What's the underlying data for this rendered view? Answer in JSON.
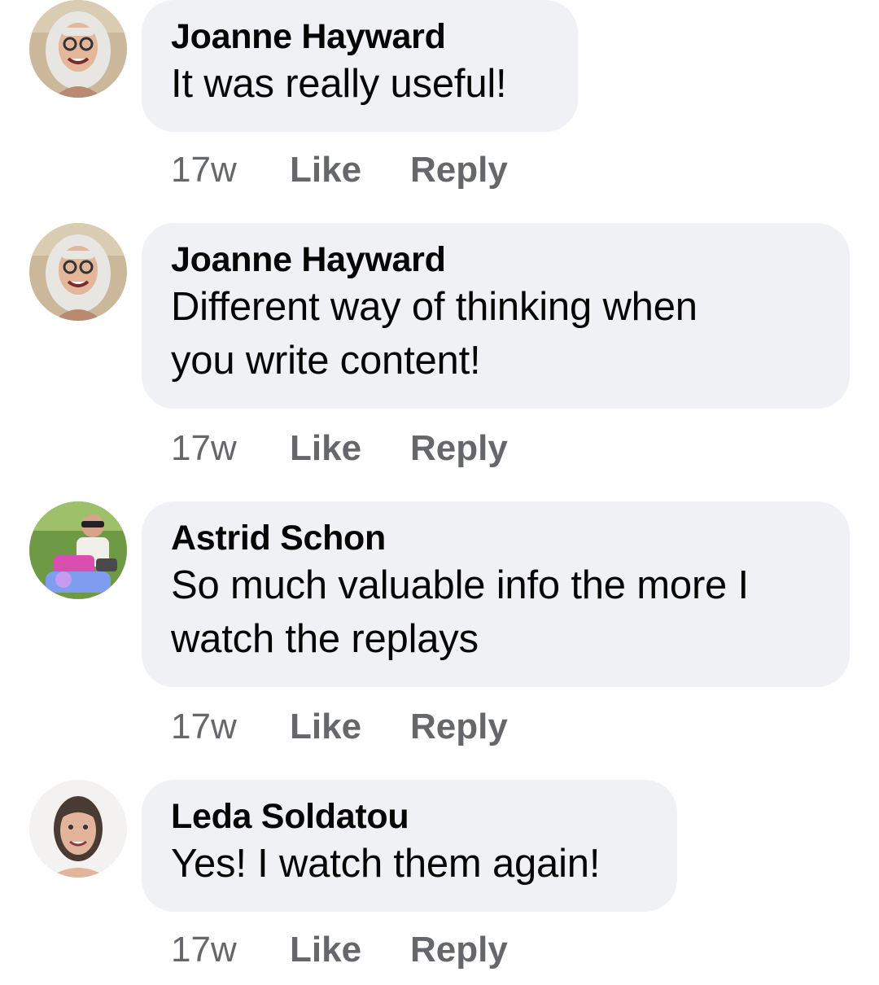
{
  "comments": [
    {
      "author": "Joanne Hayward",
      "text": "It was really useful!",
      "time": "17w",
      "like_label": "Like",
      "reply_label": "Reply",
      "avatar": "profile-photo-icon"
    },
    {
      "author": "Joanne Hayward",
      "text": "Different way of thinking when\nyou write content!",
      "time": "17w",
      "like_label": "Like",
      "reply_label": "Reply",
      "avatar": "profile-photo-icon"
    },
    {
      "author": "Astrid Schon",
      "text": "So much valuable info the more I\nwatch the replays",
      "time": "17w",
      "like_label": "Like",
      "reply_label": "Reply",
      "avatar": "profile-photo-icon"
    },
    {
      "author": "Leda Soldatou",
      "text": "Yes! I watch them again!",
      "time": "17w",
      "like_label": "Like",
      "reply_label": "Reply",
      "avatar": "profile-photo-icon"
    }
  ],
  "colors": {
    "bubble_bg": "#f0f1f4",
    "secondary_text": "#65676b",
    "primary_text": "#050505"
  }
}
